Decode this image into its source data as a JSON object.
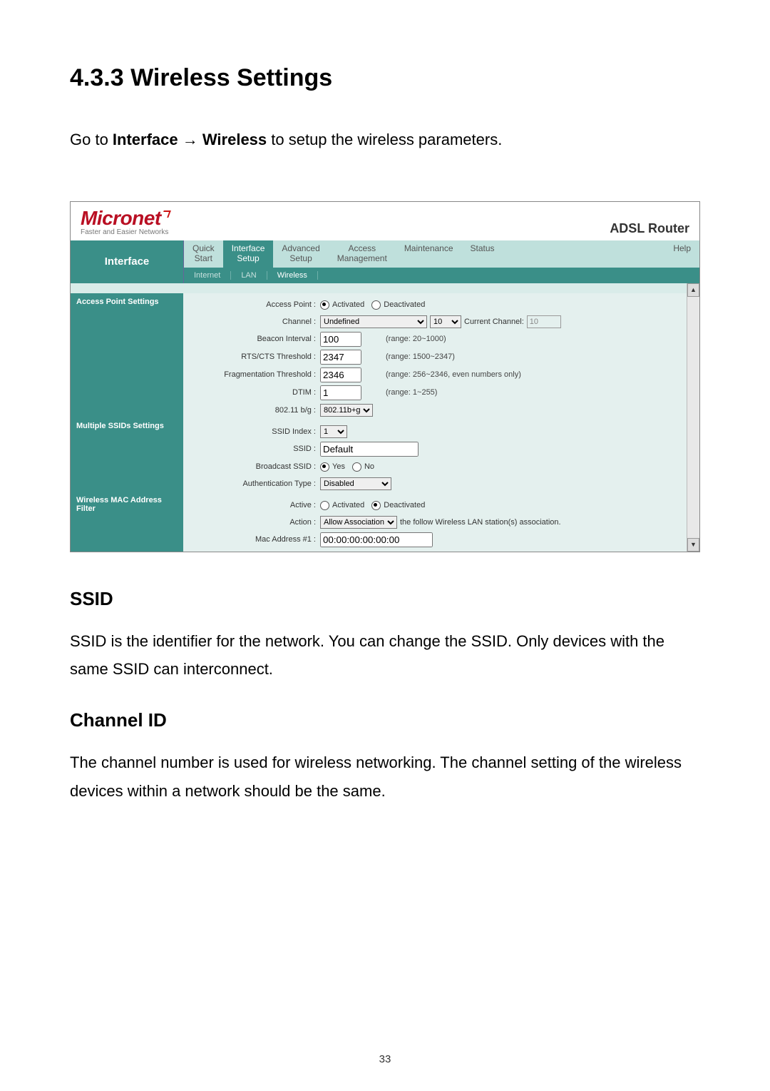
{
  "doc": {
    "section_number": "4.3.3",
    "section_title": "Wireless Settings",
    "intro_prefix": "Go to ",
    "intro_bold": "Interface → Wireless",
    "intro_suffix": " to setup the wireless parameters.",
    "ssid_heading": "SSID",
    "ssid_text": "SSID is the identifier for the network. You can change the SSID. Only devices with the same SSID can interconnect.",
    "channel_heading": "Channel ID",
    "channel_text": "The channel number is used for wireless networking. The channel setting of the wireless devices within a network should be the same.",
    "page_number": "33"
  },
  "ui": {
    "brand_logo": "Micronet",
    "brand_tag": "Faster and Easier Networks",
    "router_title": "ADSL Router",
    "left_label": "Interface",
    "tabs": {
      "quick_start": "Quick\nStart",
      "interface_setup": "Interface\nSetup",
      "advanced_setup": "Advanced\nSetup",
      "access_management": "Access\nManagement",
      "maintenance": "Maintenance",
      "status": "Status",
      "help": "Help"
    },
    "subtabs": {
      "internet": "Internet",
      "lan": "LAN",
      "wireless": "Wireless"
    },
    "sections": {
      "ap_settings": "Access Point Settings",
      "multi_ssid": "Multiple SSIDs Settings",
      "mac_filter": "Wireless MAC Address Filter"
    },
    "labels": {
      "access_point": "Access Point :",
      "activated": "Activated",
      "deactivated": "Deactivated",
      "channel": "Channel :",
      "current_channel": "Current Channel:",
      "beacon": "Beacon Interval :",
      "beacon_hint": "(range: 20~1000)",
      "rts": "RTS/CTS Threshold :",
      "rts_hint": "(range: 1500~2347)",
      "frag": "Fragmentation Threshold :",
      "frag_hint": "(range: 256~2346, even numbers only)",
      "dtim": "DTIM :",
      "dtim_hint": "(range: 1~255)",
      "bg": "802.11 b/g :",
      "ssid_index": "SSID Index :",
      "ssid": "SSID :",
      "broadcast": "Broadcast SSID :",
      "yes": "Yes",
      "no": "No",
      "auth": "Authentication Type :",
      "active": "Active :",
      "action": "Action :",
      "action_tail": "the follow Wireless LAN station(s) association.",
      "mac1": "Mac Address #1 :"
    },
    "values": {
      "channel_region": "Undefined",
      "channel_num": "10",
      "current_channel": "10",
      "beacon": "100",
      "rts": "2347",
      "frag": "2346",
      "dtim": "1",
      "bg_mode": "802.11b+g",
      "ssid_index": "1",
      "ssid": "Default",
      "auth": "Disabled",
      "action": "Allow Association",
      "mac1": "00:00:00:00:00:00"
    },
    "scroll_up": "▲",
    "scroll_down": "▼"
  }
}
